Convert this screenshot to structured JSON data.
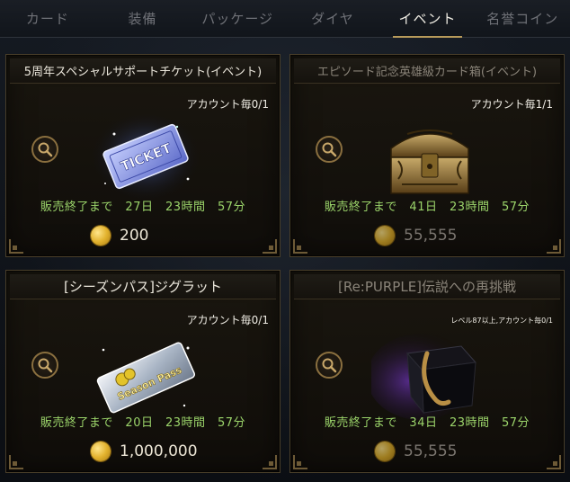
{
  "tabs": [
    {
      "label": "カード",
      "active": false
    },
    {
      "label": "装備",
      "active": false
    },
    {
      "label": "パッケージ",
      "active": false
    },
    {
      "label": "ダイヤ",
      "active": false
    },
    {
      "label": "イベント",
      "active": true
    },
    {
      "label": "名誉コイン",
      "active": false
    }
  ],
  "items": [
    {
      "title": "5周年スペシャルサポートチケット(イベント)",
      "limit": "アカウント毎0/1",
      "remaining": "販売終了まで　27日　23時間　57分",
      "price": "200",
      "icon": "ticket-icon",
      "dimmed": false
    },
    {
      "title": "エピソード記念英雄級カード箱(イベント)",
      "limit": "アカウント毎1/1",
      "remaining": "販売終了まで　41日　23時間　57分",
      "price": "55,555",
      "icon": "treasure-chest-icon",
      "dimmed": true
    },
    {
      "title": "[シーズンパス]ジグラット",
      "limit": "アカウント毎0/1",
      "remaining": "販売終了まで　20日　23時間　57分",
      "price": "1,000,000",
      "icon": "season-pass-icon",
      "pass_text": "Season Pass",
      "dimmed": false
    },
    {
      "title": "[Re:PURPLE]伝説への再挑戦",
      "limit": "レベル87以上,アカウント毎0/1",
      "remaining": "販売終了まで　34日　23時間　57分",
      "price": "55,555",
      "icon": "mystery-box-icon",
      "dimmed": true
    }
  ],
  "ticket_text": "TICKET",
  "colors": {
    "accent_gold": "#b79a5a",
    "timer_green": "#9bd46a",
    "frame_border": "#4a3f2a"
  }
}
